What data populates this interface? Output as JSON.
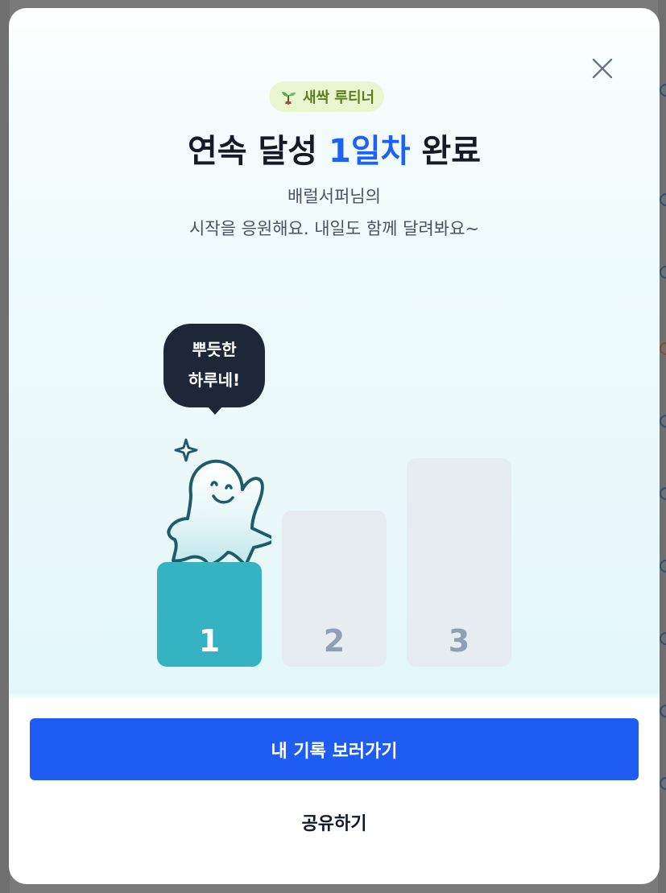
{
  "modal": {
    "badge_label": "새싹 루티너",
    "title_prefix": "연속 달성 ",
    "title_highlight": "1일차",
    "title_suffix": " 완료",
    "subtitle_line1": "배럴서퍼님의",
    "subtitle_line2": "시작을 응원해요. 내일도 함께 달려봐요~",
    "speech_bubble_line1": "뿌듯한",
    "speech_bubble_line2": "하루네!",
    "podium": [
      {
        "label": "1",
        "active": true
      },
      {
        "label": "2",
        "active": false
      },
      {
        "label": "3",
        "active": false
      }
    ],
    "primary_button_label": "내 기록 보러가기",
    "share_button_label": "공유하기",
    "close_icon": "close-icon"
  },
  "colors": {
    "accent_blue": "#1e61f5",
    "podium_active": "#36b3c3",
    "podium_inactive": "#e6edf1",
    "badge_bg": "#e8f7cf",
    "badge_text": "#5a7d1d",
    "bubble_bg": "#1d2738"
  }
}
